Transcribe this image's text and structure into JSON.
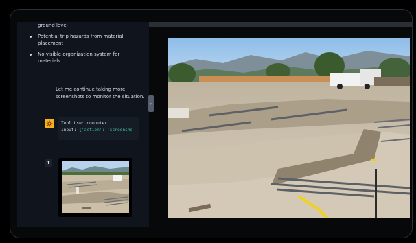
{
  "transcript": {
    "bullets": [
      {
        "text": "ground level",
        "dot": false
      },
      {
        "text": "Potential trip hazards from material placement",
        "dot": true
      },
      {
        "text": "No visible organization system for materials",
        "dot": true
      }
    ],
    "message": "Let me continue taking more screenshots to monitor the situation.",
    "tool_call": {
      "line1": "Tool Use: computer",
      "input_label": "Input: ",
      "input_value": "{'action': 'screensho"
    },
    "tool_result_avatar": "T"
  },
  "colors": {
    "sidebar_bg": "#0f141d",
    "tool_icon": "#f5b21a",
    "code_string": "#3fc3a5",
    "device_border": "#2c2f36"
  },
  "icons": {
    "tool": "claude-logo-icon",
    "collapse": "chevron-icon"
  }
}
